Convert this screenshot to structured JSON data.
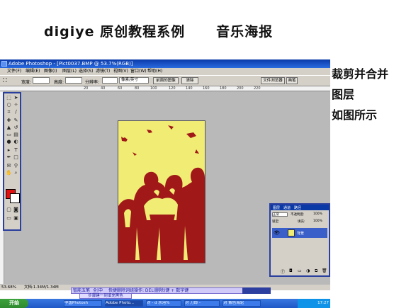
{
  "slide": {
    "title": "digiye 原创教程系例",
    "subtitle": "音乐海报",
    "notes": [
      "裁剪并合并",
      "图层",
      "如图所示"
    ]
  },
  "window": {
    "title": "Adobe Photoshop - [Pict0037.BMP @ 53.7%(RGB)]"
  },
  "menu": [
    "文件(F)",
    "编辑(E)",
    "图像(I)",
    "图层(L)",
    "选择(S)",
    "滤镜(T)",
    "视图(V)",
    "窗口(W)",
    "帮助(H)"
  ],
  "options": {
    "width_label": "宽度:",
    "height_label": "高度:",
    "resolution_label": "分辨率:",
    "unit": "像素/英寸",
    "front_image_button": "前面的图像",
    "clear_button": "清除",
    "file_browser_tab": "文件浏览器",
    "brush_tab": "画笔"
  },
  "ruler_ticks": [
    "20",
    "40",
    "60",
    "80",
    "100",
    "120",
    "140",
    "160",
    "180",
    "200",
    "220"
  ],
  "layers_panel": {
    "tabs": [
      "图层",
      "通道",
      "路径"
    ],
    "blend_mode": "正常",
    "opacity_label": "不透明度:",
    "opacity": "100%",
    "lock_label": "锁定:",
    "fill_label": "填充:",
    "fill": "100%",
    "layer_name": "背景"
  },
  "status": {
    "zoom": "53.68%",
    "doc_size": "文档:1.34M/1.34M"
  },
  "hint_bar": {
    "left": "智能五笔",
    "left2": "全|中",
    "text": "快捷删除词组操作: DEL(删除)键 + 数字键",
    "sub": "步骤建一到填充黑色"
  },
  "taskbar": {
    "start": "开始",
    "items": [
      "中国Photosh",
      "Adobe Photo...",
      "对 - d 水溶%",
      "对 刀郎 -",
      "对 紫色海轮"
    ],
    "time": "17:27"
  },
  "colors": {
    "foreground": "#e01010",
    "background": "#ffffff",
    "poster_light": "#f0ec74",
    "poster_dark": "#a01818"
  }
}
